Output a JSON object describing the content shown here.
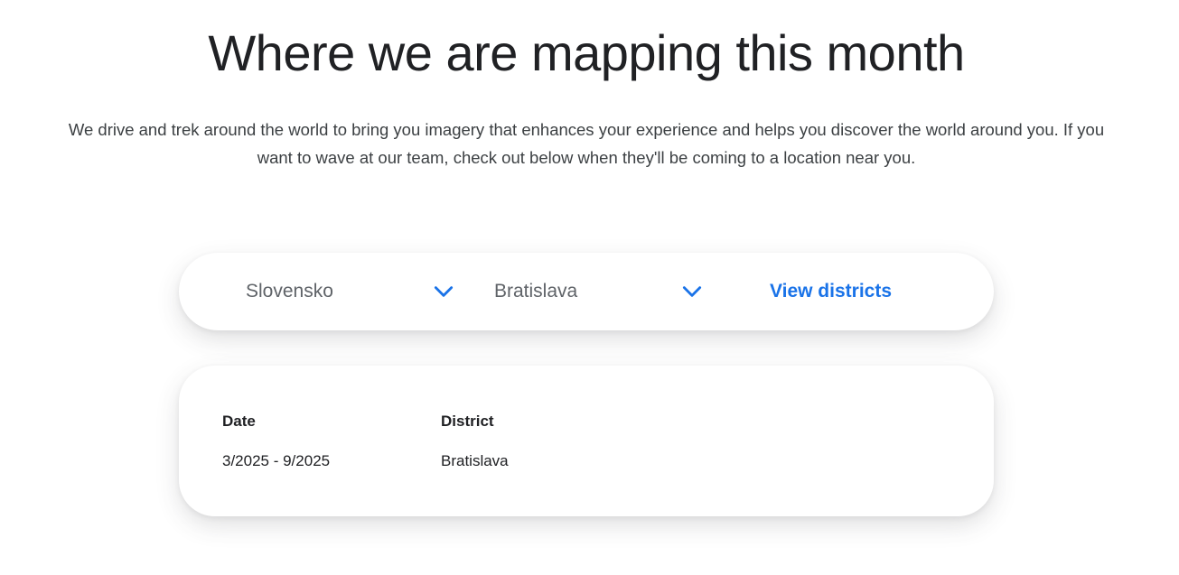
{
  "header": {
    "title": "Where we are mapping this month",
    "intro": "We drive and trek around the world to bring you imagery that enhances your experience and helps you discover the world around you. If you want to wave at our team, check out below when they'll be coming to a location near you."
  },
  "selectors": {
    "country": {
      "value": "Slovensko",
      "icon": "chevron-down-icon"
    },
    "city": {
      "value": "Bratislava",
      "icon": "chevron-down-icon"
    },
    "view_districts_label": "View districts"
  },
  "results": {
    "columns": [
      "Date",
      "District"
    ],
    "rows": [
      {
        "date": "3/2025 - 9/2025",
        "district": "Bratislava"
      }
    ]
  },
  "colors": {
    "accent": "#1a73e8",
    "text": "#202124",
    "muted": "#5f6368"
  }
}
